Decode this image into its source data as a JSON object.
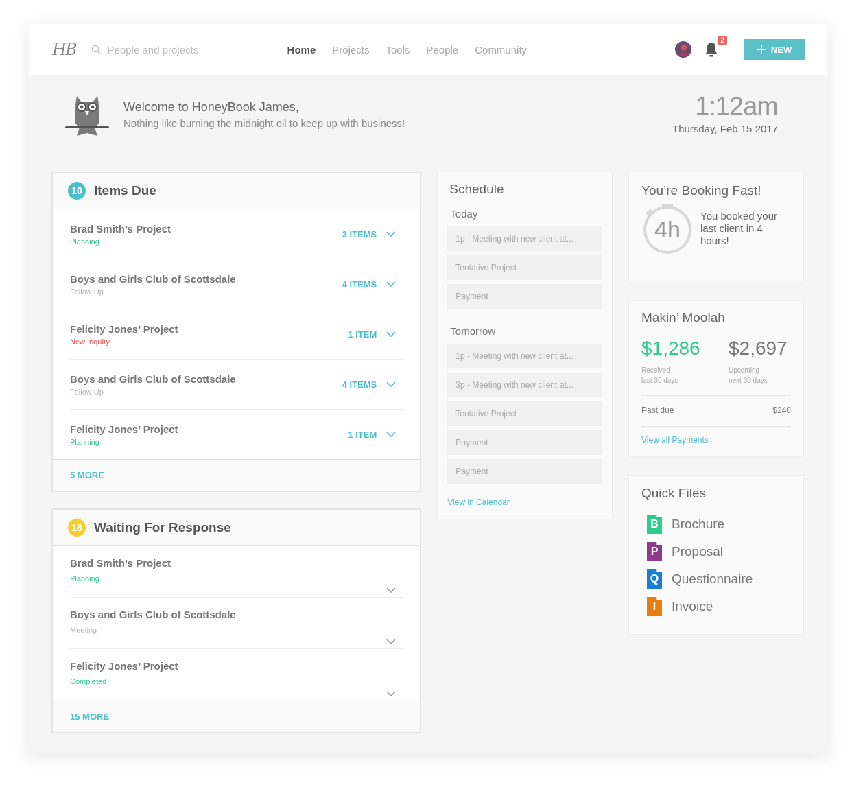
{
  "header": {
    "logo": "HB",
    "search": {
      "placeholder": "People and projects"
    },
    "nav": [
      {
        "label": "Home",
        "selected": true
      },
      {
        "label": "Projects",
        "selected": false
      },
      {
        "label": "Tools",
        "selected": false
      },
      {
        "label": "People",
        "selected": false
      },
      {
        "label": "Community",
        "selected": false
      }
    ],
    "notifications": "2",
    "new_button": "NEW"
  },
  "welcome": {
    "title": "Welcome to HoneyBook James,",
    "subtitle": "Nothing like burning the midnight oil to keep up with business!",
    "time": "1:12am",
    "date": "Thursday, Feb 15 2017"
  },
  "sections": [
    {
      "count": "10",
      "color": "#4bbfcb",
      "title": "Items Due",
      "more": "5 MORE",
      "rows": [
        {
          "name": "Brad Smith’s Project",
          "status": "Planning",
          "color": "#2ecc8f",
          "items": "3 ITEMS"
        },
        {
          "name": "Boys and Girls Club of Scottsdale",
          "status": "Follow Up",
          "color": "#b5b5b5",
          "items": "4 ITEMS"
        },
        {
          "name": "Felicity Jones’ Project",
          "status": "New Inquiry",
          "color": "#f0514f",
          "items": "1 ITEM"
        },
        {
          "name": "Boys and Girls Club of Scottsdale",
          "status": "Follow Up",
          "color": "#b5b5b5",
          "items": "4 ITEMS"
        },
        {
          "name": "Felicity Jones’ Project",
          "status": "Planning",
          "color": "#2ecc8f",
          "items": "1 ITEM"
        }
      ]
    },
    {
      "count": "18",
      "color": "#f5cf2a",
      "title": "Waiting For Response",
      "more": "15 MORE",
      "rows": [
        {
          "name": "Brad Smith’s Project",
          "status": "Planning",
          "color": "#2ecc8f"
        },
        {
          "name": "Boys and Girls Club of Scottsdale",
          "status": "Meeting",
          "color": "#b5b5b5"
        },
        {
          "name": "Felicity Jones’ Project",
          "status": "Completed",
          "color": "#2ecc8f"
        }
      ]
    }
  ],
  "schedule": {
    "title": "Schedule",
    "days": [
      {
        "label": "Today",
        "events": [
          "1p - Meeting with new client at...",
          "Tentative Project",
          "Payment"
        ]
      },
      {
        "label": "Tomorrow",
        "events": [
          "1p - Meeting with new client at...",
          "3p - Meeting with new client at...",
          "Tentative Project",
          "Payment",
          "Payment"
        ]
      }
    ],
    "link": "View in Calendar"
  },
  "booking": {
    "title": "You’re Booking Fast!",
    "timer": "4h",
    "text": "You booked your last client in 4 hours!"
  },
  "moolah": {
    "title": "Makin’ Moolah",
    "amounts": [
      {
        "value": "$1,286",
        "color": "#2ecc8f",
        "label": "Received",
        "period": "last 30 days"
      },
      {
        "value": "$2,697",
        "color": "#777777",
        "label": "Upcoming",
        "period": "next 30 days"
      }
    ],
    "past_due_label": "Past due",
    "past_due_value": "$240",
    "link": "View all Payments"
  },
  "quick_files": {
    "title": "Quick Files",
    "files": [
      {
        "letter": "B",
        "name": "Brochure",
        "color": "#2ecc8f"
      },
      {
        "letter": "P",
        "name": "Proposal",
        "color": "#8e3a8c"
      },
      {
        "letter": "Q",
        "name": "Questionnaire",
        "color": "#1a7fd4"
      },
      {
        "letter": "I",
        "name": "Invoice",
        "color": "#e87d0f"
      }
    ]
  }
}
